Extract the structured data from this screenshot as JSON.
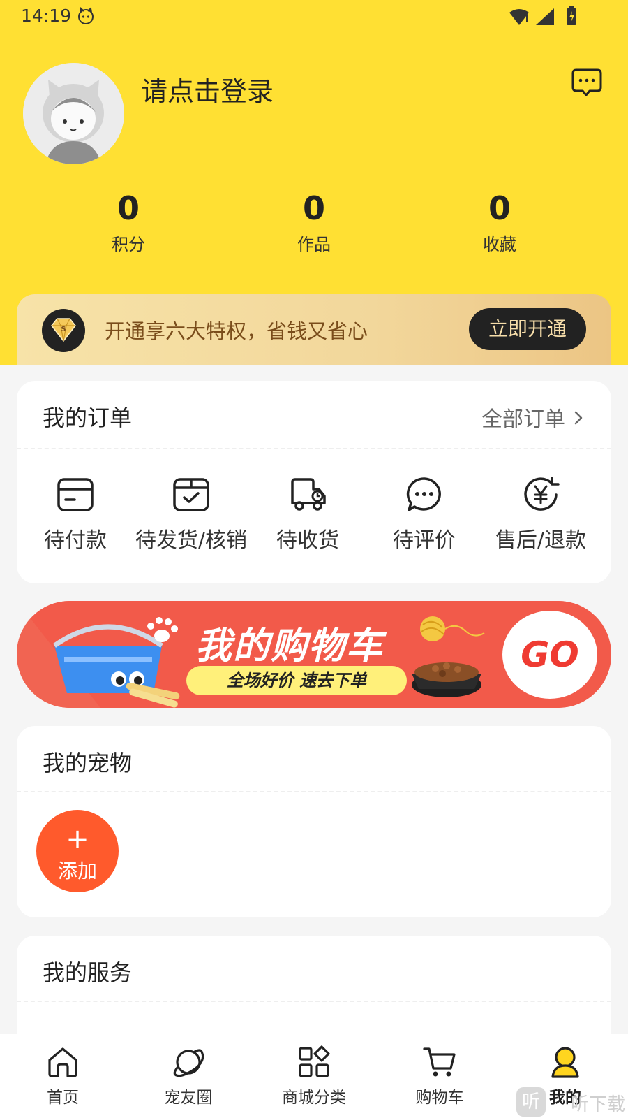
{
  "status_bar": {
    "time": "14:19"
  },
  "profile": {
    "login_prompt": "请点击登录"
  },
  "stats": [
    {
      "value": "0",
      "label": "积分"
    },
    {
      "value": "0",
      "label": "作品"
    },
    {
      "value": "0",
      "label": "收藏"
    }
  ],
  "vip": {
    "text": "开通享六大特权，省钱又省心",
    "button": "立即开通"
  },
  "orders": {
    "title": "我的订单",
    "all_link": "全部订单",
    "items": [
      {
        "label": "待付款",
        "icon": "card-icon"
      },
      {
        "label": "待发货/核销",
        "icon": "package-check-icon"
      },
      {
        "label": "待收货",
        "icon": "delivery-truck-icon"
      },
      {
        "label": "待评价",
        "icon": "chat-bubble-icon"
      },
      {
        "label": "售后/退款",
        "icon": "refund-yen-icon"
      }
    ]
  },
  "banner": {
    "title": "我的购物车",
    "subtitle": "全场好价 速去下单",
    "go": "GO"
  },
  "pets": {
    "title": "我的宠物",
    "add_label": "添加"
  },
  "services": {
    "title": "我的服务"
  },
  "tabbar": [
    {
      "label": "首页",
      "icon": "home-icon"
    },
    {
      "label": "宠友圈",
      "icon": "planet-icon"
    },
    {
      "label": "商城分类",
      "icon": "category-icon"
    },
    {
      "label": "购物车",
      "icon": "cart-icon"
    },
    {
      "label": "我的",
      "icon": "user-icon",
      "active": true
    }
  ],
  "watermark": {
    "logo": "听",
    "text": "听下载"
  },
  "colors": {
    "brand_yellow": "#ffe033",
    "add_orange": "#ff5a2c",
    "banner_red": "#f25a4a",
    "vip_gold": "#f2d79b"
  }
}
